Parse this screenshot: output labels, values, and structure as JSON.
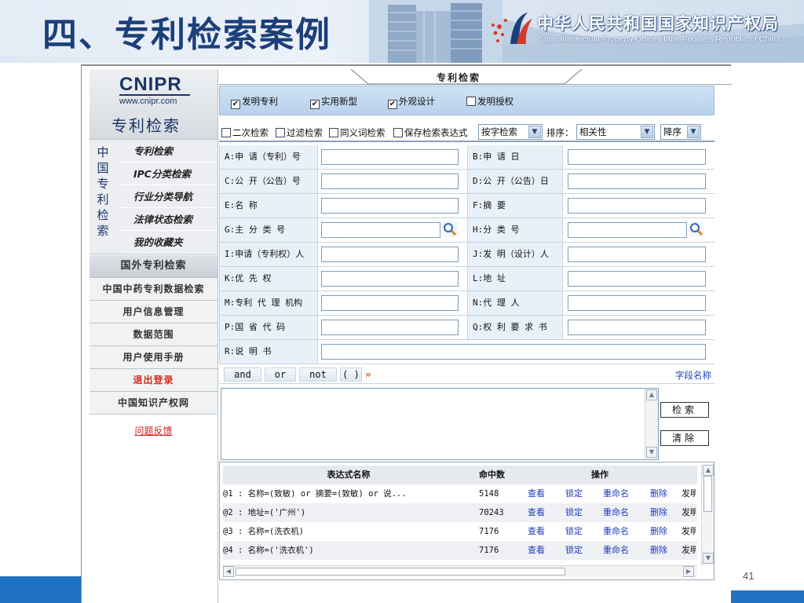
{
  "slide": {
    "title": "四、专利检索案例",
    "org_cn": "中华人民共和国国家知识产权局",
    "org_en": "State Intellectual Property Office of the People's Republic of China",
    "page_number": "41"
  },
  "sidebar": {
    "brand": "CNIPR",
    "brand_url": "www.cnipr.com",
    "brand_search": "专利检索",
    "vertical_label": [
      "中",
      "国",
      "专",
      "利",
      "检",
      "索"
    ],
    "menu": [
      {
        "label": "专利检索"
      },
      {
        "label": "IPC分类检索"
      },
      {
        "label": "行业分类导航"
      },
      {
        "label": "法律状态检索"
      },
      {
        "label": "我的收藏夹"
      }
    ],
    "rows": [
      {
        "label": "国外专利检索"
      },
      {
        "label": "中国中药专利数据检索"
      },
      {
        "label": "用户信息管理"
      },
      {
        "label": "数据范围"
      },
      {
        "label": "用户使用手册"
      },
      {
        "label": "退出登录"
      },
      {
        "label": "中国知识产权网"
      }
    ],
    "feedback": "问题反馈"
  },
  "main": {
    "tab_label": "专利检索",
    "types": [
      {
        "label": "发明专利",
        "checked": true
      },
      {
        "label": "实用新型",
        "checked": true
      },
      {
        "label": "外观设计",
        "checked": true
      },
      {
        "label": "发明授权",
        "checked": false
      }
    ],
    "options": [
      {
        "label": "二次检索",
        "checked": false
      },
      {
        "label": "过滤检索",
        "checked": false
      },
      {
        "label": "同义词检索",
        "checked": false
      },
      {
        "label": "保存检索表达式",
        "checked": false
      }
    ],
    "search_mode": "按字检索",
    "sort_label": "排序：",
    "sort_field": "相关性",
    "sort_order": "降序",
    "check_mark": "✔",
    "fields": [
      {
        "left": "A:申 请（专利）号",
        "right": "B:申    请    日"
      },
      {
        "left": "C:公 开（公告）号",
        "right": "D:公 开（公告）日"
      },
      {
        "left": "E:名          称",
        "right": "F:摘          要"
      },
      {
        "left": "G:主  分  类  号",
        "right": "H:分    类    号"
      },
      {
        "left": "I:申请（专利权）人",
        "right": "J:发 明（设计）人"
      },
      {
        "left": "K:优    先    权",
        "right": "L:地          址"
      },
      {
        "left": "M:专利 代 理 机构",
        "right": "N:代    理    人"
      },
      {
        "left": "P:国  省  代  码",
        "right": "Q:权 利 要 求 书"
      },
      {
        "left": "R:说    明    书",
        "right": ""
      }
    ],
    "operators": [
      "and",
      "or",
      "not",
      "( )"
    ],
    "more_icon": "»",
    "field_names_link": "字段名称",
    "search_button": "检索",
    "clear_button": "清除"
  },
  "results": {
    "headers": {
      "name": "表达式名称",
      "hits": "命中数",
      "ops": "操作"
    },
    "rows": [
      {
        "name": "@1 : 名称=(致敏) or 摘要=(致敏) or 说...",
        "hits": "5148"
      },
      {
        "name": "@2 : 地址=('广州')",
        "hits": "70243"
      },
      {
        "name": "@3 : 名称=(洗衣机)",
        "hits": "7176"
      },
      {
        "name": "@4 : 名称=('洗衣机')",
        "hits": "7176"
      }
    ],
    "actions": [
      "查看",
      "锁定",
      "重命名",
      "删除",
      "发明"
    ]
  },
  "colors": {
    "title": "#1c3f7a",
    "brand": "#1c3567",
    "link": "#1d3dbf",
    "logout": "#d42a1c",
    "accent_band": "#1f72c4"
  },
  "icons": {
    "magnifier": "search-icon",
    "dropdown": "chevron-down-icon",
    "more": "double-chevron-right-icon"
  }
}
